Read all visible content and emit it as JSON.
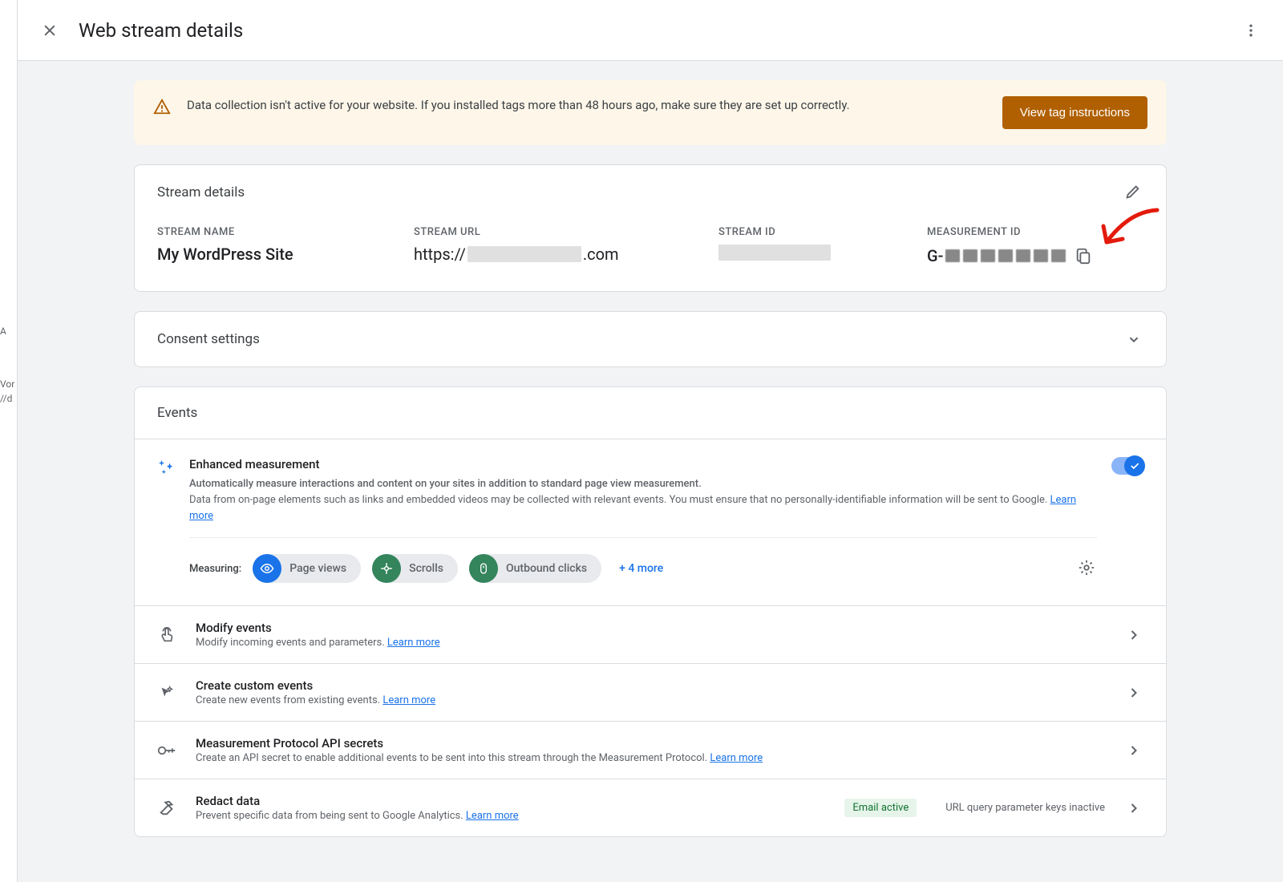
{
  "header": {
    "title": "Web stream details"
  },
  "bg_strip": {
    "line1": "A",
    "line2": "Vor",
    "line3": "//d"
  },
  "banner": {
    "text": "Data collection isn't active for your website. If you installed tags more than 48 hours ago, make sure they are set up correctly.",
    "button": "View tag instructions"
  },
  "stream_details": {
    "heading": "Stream details",
    "cols": {
      "name_label": "STREAM NAME",
      "name_value": "My WordPress Site",
      "url_label": "STREAM URL",
      "url_prefix": "https://",
      "url_suffix": ".com",
      "id_label": "STREAM ID",
      "mid_label": "MEASUREMENT ID",
      "mid_prefix": "G-"
    }
  },
  "consent": {
    "heading": "Consent settings"
  },
  "events": {
    "heading": "Events",
    "enhanced": {
      "title": "Enhanced measurement",
      "line1": "Automatically measure interactions and content on your sites in addition to standard page view measurement.",
      "line2": "Data from on-page elements such as links and embedded videos may be collected with relevant events. You must ensure that no personally-identifiable information will be sent to Google. ",
      "learn_more": "Learn more"
    },
    "measuring": {
      "label": "Measuring:",
      "chips": [
        "Page views",
        "Scrolls",
        "Outbound clicks"
      ],
      "more": "+ 4 more"
    },
    "rows": [
      {
        "title": "Modify events",
        "sub": "Modify incoming events and parameters. ",
        "learn_more": "Learn more"
      },
      {
        "title": "Create custom events",
        "sub": "Create new events from existing events. ",
        "learn_more": "Learn more"
      },
      {
        "title": "Measurement Protocol API secrets",
        "sub": "Create an API secret to enable additional events to be sent into this stream through the Measurement Protocol. ",
        "learn_more": "Learn more"
      },
      {
        "title": "Redact data",
        "sub": "Prevent specific data from being sent to Google Analytics. ",
        "learn_more": "Learn more",
        "badge_green": "Email active",
        "badge_gray": "URL query parameter keys inactive"
      }
    ]
  }
}
